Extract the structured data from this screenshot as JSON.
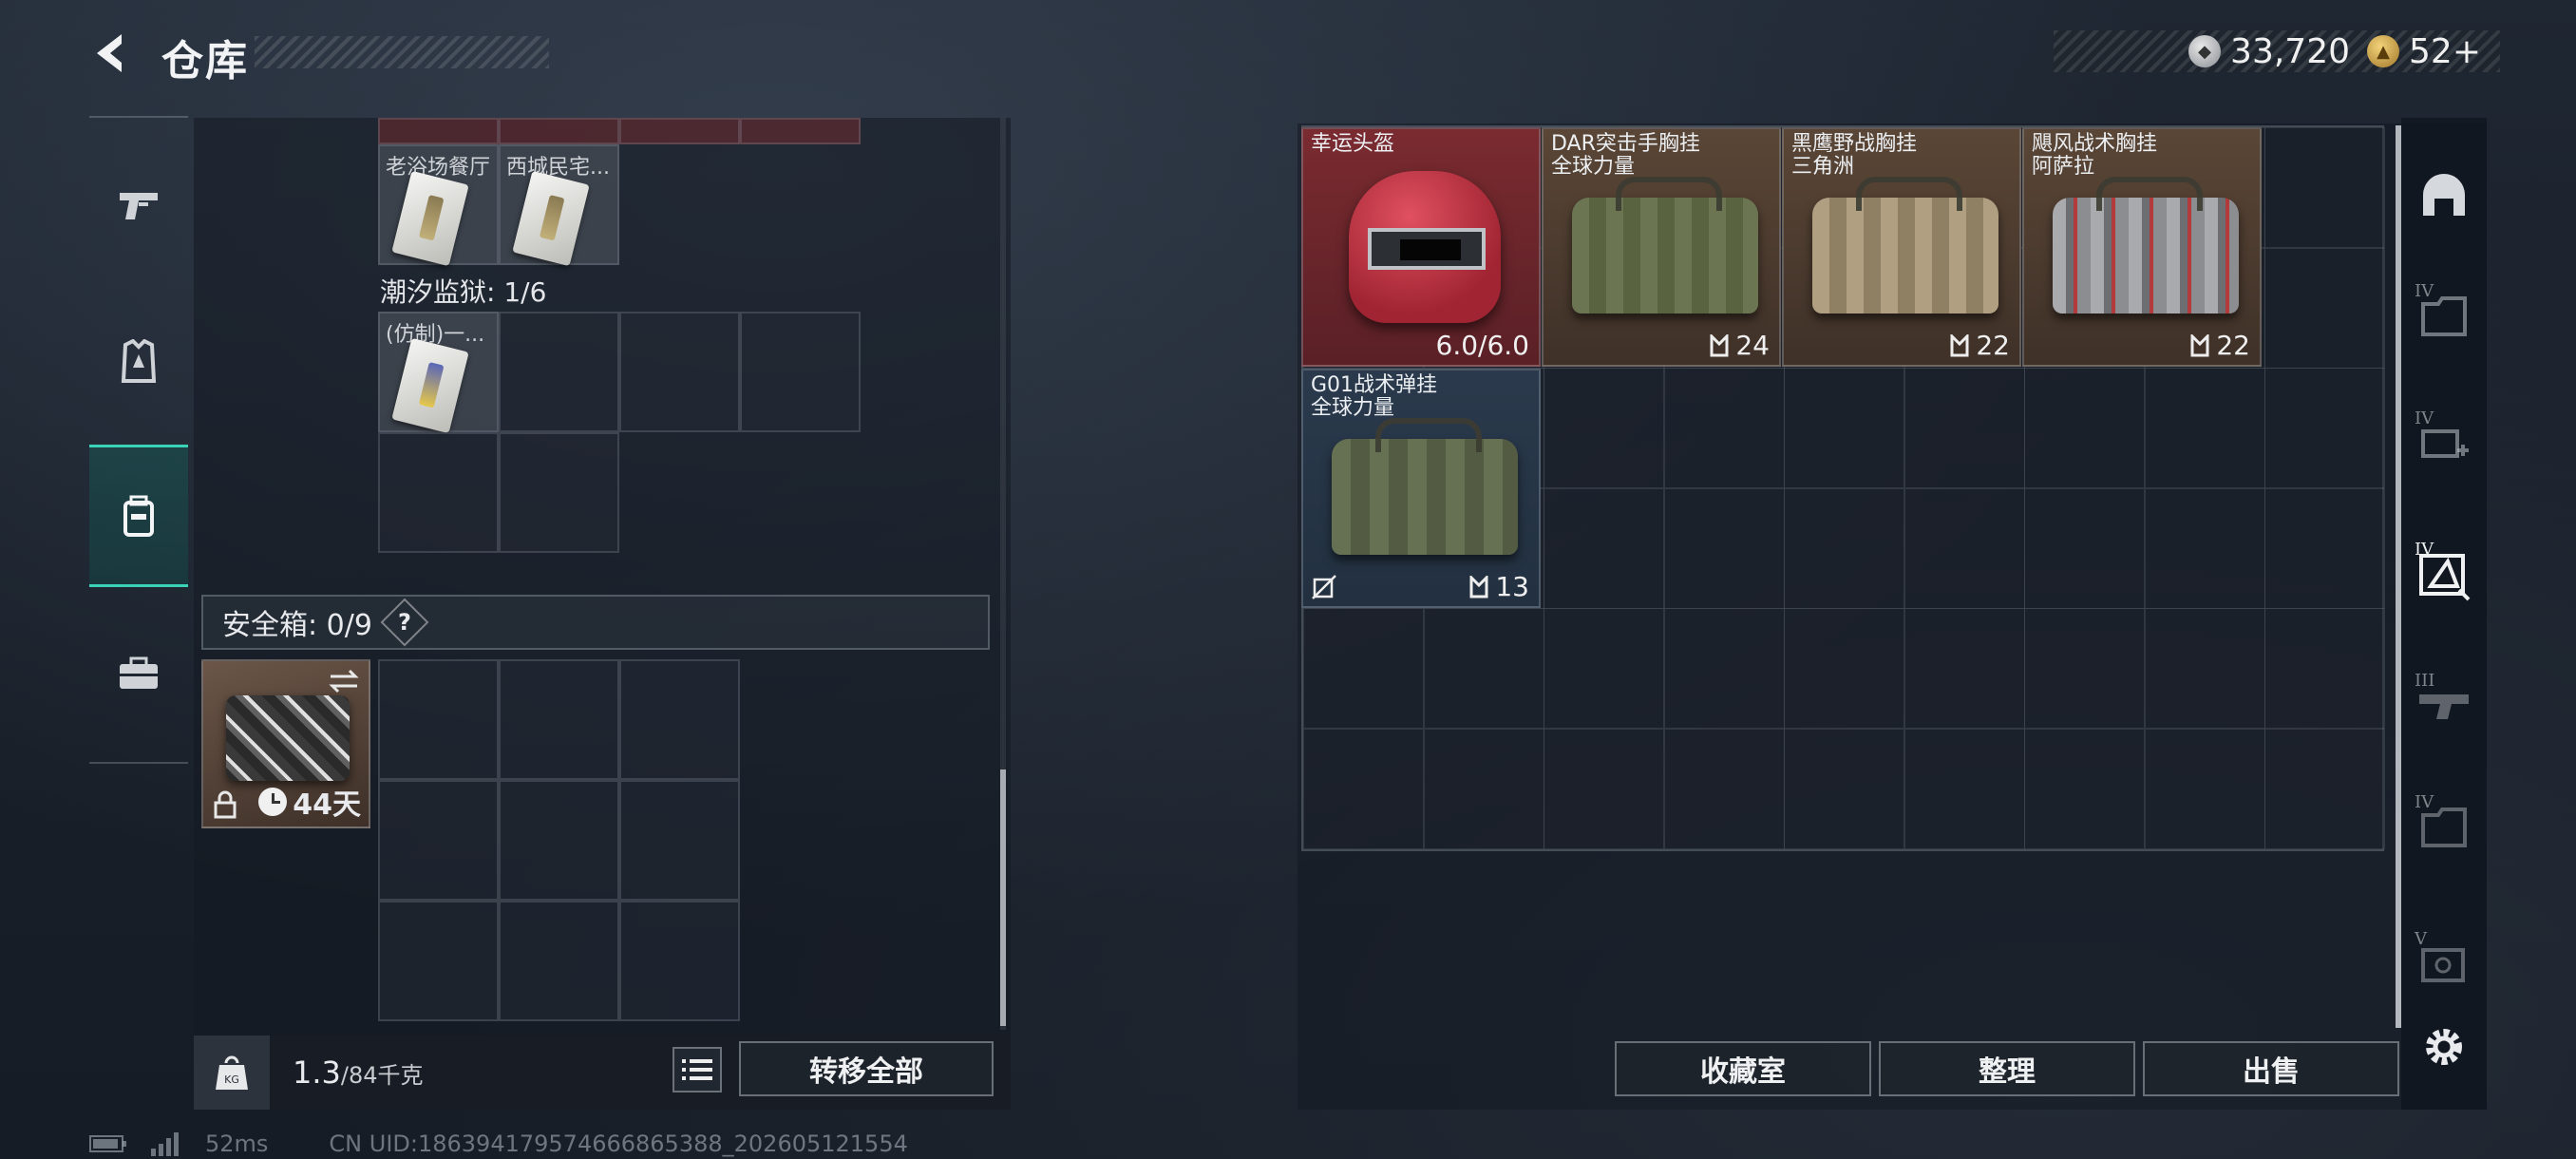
{
  "header": {
    "title": "仓库",
    "currency": [
      {
        "icon": "silver-coin-icon",
        "value": "33,720"
      },
      {
        "icon": "gold-coin-icon",
        "value": "52+"
      }
    ]
  },
  "sidebar": {
    "items": [
      {
        "name": "weapons-tab",
        "icon": "pistol-icon"
      },
      {
        "name": "equipment-tab",
        "icon": "armor-icon"
      },
      {
        "name": "backpack-tab",
        "icon": "backpack-icon",
        "active": true
      },
      {
        "name": "supplies-tab",
        "icon": "toolbox-icon"
      }
    ]
  },
  "left": {
    "keycards_top": [
      {
        "label": "老浴场餐厅"
      },
      {
        "label": "西城民宅..."
      }
    ],
    "prison_label": "潮汐监狱: 1/6",
    "prison_cards": [
      {
        "label": "(仿制)一..."
      }
    ],
    "safebox_label": "安全箱: 0/9",
    "safebox_help": "?",
    "safebox_days": "44天",
    "weight_value": "1.3",
    "weight_max": "/84千克",
    "transfer_all": "转移全部"
  },
  "right": {
    "items": [
      {
        "name": "幸运头盔",
        "subtitle": "",
        "qty": "6.0/6.0",
        "type": "helmet"
      },
      {
        "name": "DAR突击手胸挂",
        "subtitle": "全球力量",
        "qty": "24",
        "type": "bag-green"
      },
      {
        "name": "黑鹰野战胸挂",
        "subtitle": "三角洲",
        "qty": "22",
        "type": "bag-tan"
      },
      {
        "name": "飓风战术胸挂",
        "subtitle": "阿萨拉",
        "qty": "22",
        "type": "bag-grey"
      },
      {
        "name": "G01战术弹挂",
        "subtitle": "全球力量",
        "qty": "13",
        "type": "bag-olive"
      }
    ],
    "buttons": {
      "collection": "收藏室",
      "sort": "整理",
      "sell": "出售"
    },
    "categories": [
      {
        "name": "helmet-category",
        "roman": ""
      },
      {
        "name": "armor-iv-category",
        "roman": "IV"
      },
      {
        "name": "medkit-iv-category",
        "roman": "IV"
      },
      {
        "name": "rig-iv-category",
        "roman": "IV"
      },
      {
        "name": "rig-iii-category",
        "roman": "III"
      },
      {
        "name": "backpack-iv-category",
        "roman": "IV"
      },
      {
        "name": "backpack-v-category",
        "roman": "V"
      }
    ]
  },
  "footer": {
    "ping": "52ms",
    "uid": "CN UID:1863941795746668653​88_202605121554"
  },
  "colors": {
    "accent_teal": "#3bd3b8",
    "helmet_red": "#7a2b30",
    "item_brown": "#5a4636",
    "item_blue": "#2a3a4c"
  }
}
